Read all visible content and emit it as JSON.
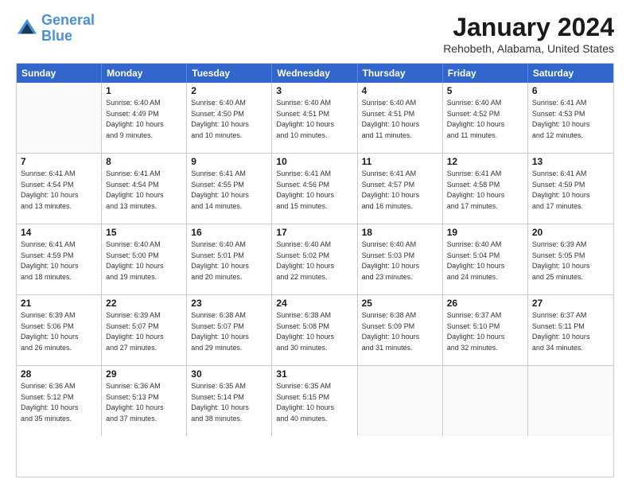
{
  "logo": {
    "line1": "General",
    "line2": "Blue"
  },
  "title": "January 2024",
  "subtitle": "Rehobeth, Alabama, United States",
  "calendar": {
    "headers": [
      "Sunday",
      "Monday",
      "Tuesday",
      "Wednesday",
      "Thursday",
      "Friday",
      "Saturday"
    ],
    "rows": [
      [
        {
          "day": "",
          "info": ""
        },
        {
          "day": "1",
          "info": "Sunrise: 6:40 AM\nSunset: 4:49 PM\nDaylight: 10 hours\nand 9 minutes."
        },
        {
          "day": "2",
          "info": "Sunrise: 6:40 AM\nSunset: 4:50 PM\nDaylight: 10 hours\nand 10 minutes."
        },
        {
          "day": "3",
          "info": "Sunrise: 6:40 AM\nSunset: 4:51 PM\nDaylight: 10 hours\nand 10 minutes."
        },
        {
          "day": "4",
          "info": "Sunrise: 6:40 AM\nSunset: 4:51 PM\nDaylight: 10 hours\nand 11 minutes."
        },
        {
          "day": "5",
          "info": "Sunrise: 6:40 AM\nSunset: 4:52 PM\nDaylight: 10 hours\nand 11 minutes."
        },
        {
          "day": "6",
          "info": "Sunrise: 6:41 AM\nSunset: 4:53 PM\nDaylight: 10 hours\nand 12 minutes."
        }
      ],
      [
        {
          "day": "7",
          "info": "Sunrise: 6:41 AM\nSunset: 4:54 PM\nDaylight: 10 hours\nand 13 minutes."
        },
        {
          "day": "8",
          "info": "Sunrise: 6:41 AM\nSunset: 4:54 PM\nDaylight: 10 hours\nand 13 minutes."
        },
        {
          "day": "9",
          "info": "Sunrise: 6:41 AM\nSunset: 4:55 PM\nDaylight: 10 hours\nand 14 minutes."
        },
        {
          "day": "10",
          "info": "Sunrise: 6:41 AM\nSunset: 4:56 PM\nDaylight: 10 hours\nand 15 minutes."
        },
        {
          "day": "11",
          "info": "Sunrise: 6:41 AM\nSunset: 4:57 PM\nDaylight: 10 hours\nand 16 minutes."
        },
        {
          "day": "12",
          "info": "Sunrise: 6:41 AM\nSunset: 4:58 PM\nDaylight: 10 hours\nand 17 minutes."
        },
        {
          "day": "13",
          "info": "Sunrise: 6:41 AM\nSunset: 4:59 PM\nDaylight: 10 hours\nand 17 minutes."
        }
      ],
      [
        {
          "day": "14",
          "info": "Sunrise: 6:41 AM\nSunset: 4:59 PM\nDaylight: 10 hours\nand 18 minutes."
        },
        {
          "day": "15",
          "info": "Sunrise: 6:40 AM\nSunset: 5:00 PM\nDaylight: 10 hours\nand 19 minutes."
        },
        {
          "day": "16",
          "info": "Sunrise: 6:40 AM\nSunset: 5:01 PM\nDaylight: 10 hours\nand 20 minutes."
        },
        {
          "day": "17",
          "info": "Sunrise: 6:40 AM\nSunset: 5:02 PM\nDaylight: 10 hours\nand 22 minutes."
        },
        {
          "day": "18",
          "info": "Sunrise: 6:40 AM\nSunset: 5:03 PM\nDaylight: 10 hours\nand 23 minutes."
        },
        {
          "day": "19",
          "info": "Sunrise: 6:40 AM\nSunset: 5:04 PM\nDaylight: 10 hours\nand 24 minutes."
        },
        {
          "day": "20",
          "info": "Sunrise: 6:39 AM\nSunset: 5:05 PM\nDaylight: 10 hours\nand 25 minutes."
        }
      ],
      [
        {
          "day": "21",
          "info": "Sunrise: 6:39 AM\nSunset: 5:06 PM\nDaylight: 10 hours\nand 26 minutes."
        },
        {
          "day": "22",
          "info": "Sunrise: 6:39 AM\nSunset: 5:07 PM\nDaylight: 10 hours\nand 27 minutes."
        },
        {
          "day": "23",
          "info": "Sunrise: 6:38 AM\nSunset: 5:07 PM\nDaylight: 10 hours\nand 29 minutes."
        },
        {
          "day": "24",
          "info": "Sunrise: 6:38 AM\nSunset: 5:08 PM\nDaylight: 10 hours\nand 30 minutes."
        },
        {
          "day": "25",
          "info": "Sunrise: 6:38 AM\nSunset: 5:09 PM\nDaylight: 10 hours\nand 31 minutes."
        },
        {
          "day": "26",
          "info": "Sunrise: 6:37 AM\nSunset: 5:10 PM\nDaylight: 10 hours\nand 32 minutes."
        },
        {
          "day": "27",
          "info": "Sunrise: 6:37 AM\nSunset: 5:11 PM\nDaylight: 10 hours\nand 34 minutes."
        }
      ],
      [
        {
          "day": "28",
          "info": "Sunrise: 6:36 AM\nSunset: 5:12 PM\nDaylight: 10 hours\nand 35 minutes."
        },
        {
          "day": "29",
          "info": "Sunrise: 6:36 AM\nSunset: 5:13 PM\nDaylight: 10 hours\nand 37 minutes."
        },
        {
          "day": "30",
          "info": "Sunrise: 6:35 AM\nSunset: 5:14 PM\nDaylight: 10 hours\nand 38 minutes."
        },
        {
          "day": "31",
          "info": "Sunrise: 6:35 AM\nSunset: 5:15 PM\nDaylight: 10 hours\nand 40 minutes."
        },
        {
          "day": "",
          "info": ""
        },
        {
          "day": "",
          "info": ""
        },
        {
          "day": "",
          "info": ""
        }
      ]
    ]
  }
}
